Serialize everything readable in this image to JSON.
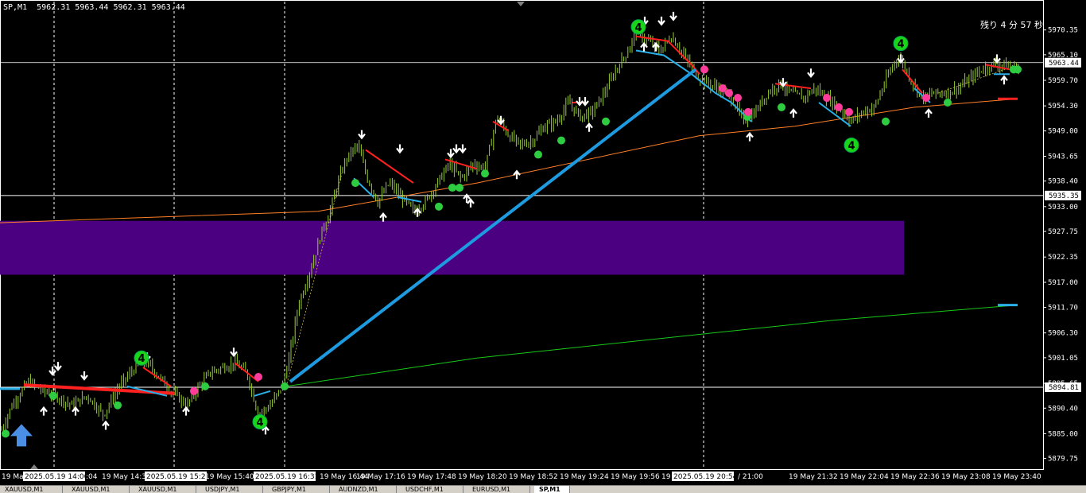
{
  "window": {
    "symbol_header": "SP,M1  5962.31 5963.44 5962.31 5963.44",
    "timer_text": "残り 4 分 57 秒"
  },
  "colors": {
    "background": "#000000",
    "grid": "#ffffff",
    "candles": "#9acd32",
    "purple_zone": "#4b0082",
    "trendline": "#1e9be0",
    "orange_line": "#ff7f27",
    "green_line": "#18c818",
    "red_ma": "#ff2020",
    "blue_ma": "#2ab0e8",
    "badge_green": "#19d419",
    "badge_pink": "#ff3c9c"
  },
  "price_axis": {
    "ticks": [
      "5970.35",
      "5965.10",
      "5959.70",
      "5954.30",
      "5949.00",
      "5943.65",
      "5938.40",
      "5933.00",
      "5927.75",
      "5922.35",
      "5917.00",
      "5911.70",
      "5906.30",
      "5901.05",
      "5895.65",
      "5890.40",
      "5885.00",
      "5879.75"
    ],
    "current_price_label": "5963.44",
    "level_label_1": "5935.35",
    "level_label_2": "5894.81"
  },
  "time_axis": {
    "labels": [
      "19 May",
      "2025.05.19 14:06",
      ":04",
      "19 May 14:3",
      "2025.05.19 15:21",
      "19 May 15:40",
      "2025.05.19 16:31",
      "19 May 16:44",
      "19 May 17:16",
      "19 May 17:48",
      "19 May 18:20",
      "19 May 18:52",
      "19 May 19:24",
      "19 May 19:56",
      "19",
      "2025.05.19 20:54",
      "/ 21:00",
      "19 May 21:32",
      "19 May 22:04",
      "19 May 22:36",
      "19 May 23:08",
      "19 May 23:40"
    ]
  },
  "bottom_tabs": [
    "XAUUSD,M1",
    "XAUUSD,M1",
    "XAUUSD,M1",
    "USDJPY,M1",
    "GBPJPY,M1",
    "AUDNZD,M1",
    "USDCHF,M1",
    "EURUSD,M1",
    "SP,M1"
  ],
  "chart_data": {
    "type": "candlestick",
    "symbol": "SP",
    "timeframe": "M1",
    "price_range": [
      5877.5,
      5975.0
    ],
    "levels": [
      5963.44,
      5935.35,
      5894.81
    ],
    "zone": [
      5918.6,
      5930.0
    ],
    "close_path": [
      [
        0,
        5885
      ],
      [
        15,
        5891
      ],
      [
        35,
        5896
      ],
      [
        55,
        5894
      ],
      [
        70,
        5893
      ],
      [
        90,
        5891
      ],
      [
        110,
        5893
      ],
      [
        130,
        5889
      ],
      [
        150,
        5895
      ],
      [
        170,
        5899
      ],
      [
        185,
        5900
      ],
      [
        200,
        5897
      ],
      [
        215,
        5894
      ],
      [
        235,
        5891
      ],
      [
        250,
        5895
      ],
      [
        265,
        5898
      ],
      [
        280,
        5899
      ],
      [
        295,
        5900
      ],
      [
        310,
        5898
      ],
      [
        325,
        5889
      ],
      [
        340,
        5891
      ],
      [
        355,
        5895
      ],
      [
        365,
        5902
      ],
      [
        375,
        5912
      ],
      [
        385,
        5917
      ],
      [
        395,
        5922
      ],
      [
        405,
        5928
      ],
      [
        415,
        5932
      ],
      [
        425,
        5938
      ],
      [
        435,
        5943
      ],
      [
        450,
        5946
      ],
      [
        462,
        5939
      ],
      [
        475,
        5934
      ],
      [
        490,
        5938
      ],
      [
        505,
        5935
      ],
      [
        520,
        5932
      ],
      [
        535,
        5934
      ],
      [
        550,
        5938
      ],
      [
        565,
        5942
      ],
      [
        580,
        5939
      ],
      [
        595,
        5942
      ],
      [
        610,
        5941
      ],
      [
        625,
        5952
      ],
      [
        640,
        5948
      ],
      [
        655,
        5946
      ],
      [
        670,
        5947
      ],
      [
        685,
        5950
      ],
      [
        700,
        5951
      ],
      [
        715,
        5955
      ],
      [
        730,
        5952
      ],
      [
        745,
        5953
      ],
      [
        760,
        5957
      ],
      [
        775,
        5962
      ],
      [
        790,
        5966
      ],
      [
        800,
        5970
      ],
      [
        815,
        5968
      ],
      [
        830,
        5966
      ],
      [
        845,
        5969
      ],
      [
        860,
        5965
      ],
      [
        875,
        5961
      ],
      [
        890,
        5959
      ],
      [
        905,
        5958
      ],
      [
        920,
        5956
      ],
      [
        935,
        5951
      ],
      [
        950,
        5953
      ],
      [
        965,
        5957
      ],
      [
        980,
        5959
      ],
      [
        995,
        5957
      ],
      [
        1010,
        5956
      ],
      [
        1025,
        5958
      ],
      [
        1040,
        5956
      ],
      [
        1055,
        5954
      ],
      [
        1070,
        5951
      ],
      [
        1085,
        5953
      ],
      [
        1100,
        5954
      ],
      [
        1115,
        5960
      ],
      [
        1130,
        5965
      ],
      [
        1145,
        5960
      ],
      [
        1160,
        5956
      ],
      [
        1175,
        5957
      ],
      [
        1190,
        5957
      ],
      [
        1205,
        5958
      ],
      [
        1220,
        5960
      ],
      [
        1235,
        5962
      ],
      [
        1250,
        5963
      ],
      [
        1265,
        5963
      ],
      [
        1283,
        5962
      ]
    ],
    "red_ma": [
      [
        800,
        5969
      ],
      [
        840,
        5968
      ],
      [
        870,
        5963
      ],
      [
        880,
        5961
      ]
    ],
    "red_ma_2": [
      [
        180,
        5899
      ],
      [
        215,
        5895
      ]
    ],
    "red_ma_3": [
      [
        295,
        5900
      ],
      [
        325,
        5896
      ]
    ],
    "red_ma_4": [
      [
        460,
        5945
      ],
      [
        520,
        5938
      ]
    ],
    "red_ma_5": [
      [
        560,
        5943
      ],
      [
        600,
        5941
      ]
    ],
    "red_ma_6": [
      [
        620,
        5951
      ],
      [
        640,
        5949
      ]
    ],
    "red_ma_7": [
      [
        720,
        5955
      ],
      [
        740,
        5955
      ]
    ],
    "red_ma_8": [
      [
        975,
        5959
      ],
      [
        1020,
        5958
      ]
    ],
    "red_ma_9": [
      [
        1135,
        5962
      ],
      [
        1160,
        5957
      ]
    ],
    "red_ma_10": [
      [
        1240,
        5963
      ],
      [
        1270,
        5962
      ]
    ],
    "red_flat": [
      [
        30,
        5895.3
      ],
      [
        220,
        5893.5
      ]
    ],
    "red_short": [
      [
        1255,
        5955.8
      ],
      [
        1280,
        5955.8
      ]
    ],
    "blue_ma": [
      [
        800,
        5966
      ],
      [
        835,
        5965
      ],
      [
        870,
        5961
      ],
      [
        900,
        5957
      ],
      [
        920,
        5955
      ],
      [
        945,
        5951
      ]
    ],
    "blue_ma_2": [
      [
        160,
        5895
      ],
      [
        210,
        5893
      ]
    ],
    "blue_ma_3": [
      [
        320,
        5893
      ],
      [
        340,
        5894
      ]
    ],
    "blue_ma_4": [
      [
        445,
        5939
      ],
      [
        470,
        5935
      ]
    ],
    "blue_ma_5": [
      [
        500,
        5935
      ],
      [
        530,
        5934
      ]
    ],
    "blue_ma_6": [
      [
        1030,
        5955
      ],
      [
        1070,
        5950
      ]
    ],
    "blue_ma_7": [
      [
        1150,
        5958
      ],
      [
        1170,
        5955
      ]
    ],
    "blue_ma_8": [
      [
        1250,
        5961
      ],
      [
        1270,
        5961
      ]
    ],
    "blue_flat": [
      [
        0,
        5894.5
      ],
      [
        25,
        5894.5
      ]
    ],
    "blue_right": [
      [
        1255,
        5912.2
      ],
      [
        1280,
        5912.2
      ]
    ],
    "trendline": [
      [
        365,
        5896
      ],
      [
        875,
        5962
      ]
    ],
    "orange_line": [
      [
        0,
        5929.6
      ],
      [
        400,
        5932
      ],
      [
        600,
        5938
      ],
      [
        880,
        5948
      ],
      [
        1000,
        5950
      ],
      [
        1150,
        5954
      ],
      [
        1280,
        5955.8
      ]
    ],
    "green_line": [
      [
        360,
        5895
      ],
      [
        600,
        5901
      ],
      [
        880,
        5906
      ],
      [
        1050,
        5909
      ],
      [
        1280,
        5912.2
      ]
    ],
    "green_badges": [
      [
        178,
        5901
      ],
      [
        327,
        5887.5
      ],
      [
        803,
        5971
      ],
      [
        1133,
        5967.5
      ],
      [
        1071,
        5946
      ]
    ],
    "down_arrows": [
      [
        66,
        5898
      ],
      [
        73,
        5899
      ],
      [
        106,
        5897
      ],
      [
        185,
        5901
      ],
      [
        294,
        5902
      ],
      [
        455,
        5948
      ],
      [
        503,
        5945
      ],
      [
        567,
        5944
      ],
      [
        574,
        5945
      ],
      [
        582,
        5945
      ],
      [
        630,
        5951
      ],
      [
        729,
        5955
      ],
      [
        736,
        5955
      ],
      [
        811,
        5972
      ],
      [
        832,
        5972
      ],
      [
        847,
        5973
      ],
      [
        985,
        5959
      ],
      [
        1020,
        5961
      ],
      [
        1133,
        5964
      ],
      [
        1254,
        5964
      ]
    ],
    "up_arrows": [
      [
        55,
        5890
      ],
      [
        95,
        5890
      ],
      [
        133,
        5887
      ],
      [
        234,
        5890
      ],
      [
        334,
        5886
      ],
      [
        482,
        5931
      ],
      [
        525,
        5932
      ],
      [
        587,
        5935
      ],
      [
        592,
        5934
      ],
      [
        650,
        5940
      ],
      [
        741,
        5950
      ],
      [
        810,
        5967
      ],
      [
        825,
        5967
      ],
      [
        943,
        5948
      ],
      [
        998,
        5953
      ],
      [
        1168,
        5953
      ],
      [
        1263,
        5960
      ]
    ],
    "up_big_arrow": [
      27,
      5884
    ]
  }
}
